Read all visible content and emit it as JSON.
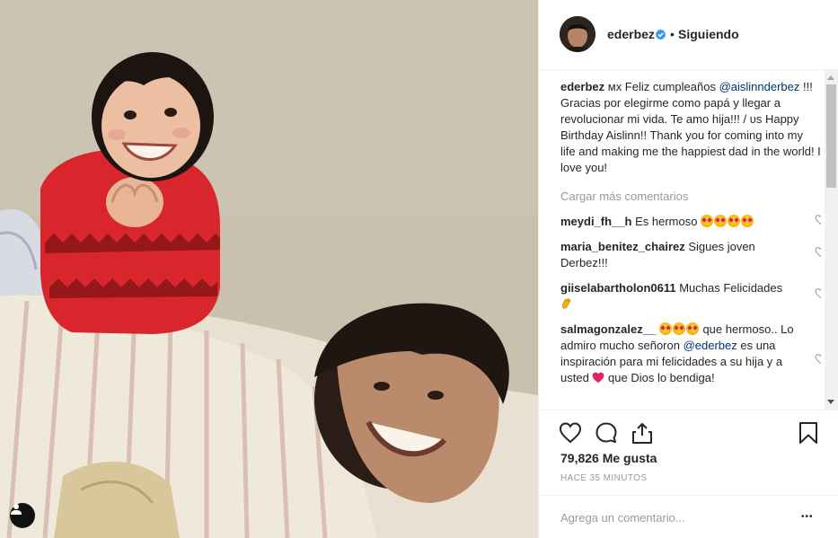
{
  "post": {
    "username": "ederbez",
    "follow_status": "Siguiendo",
    "header_separator": "•",
    "caption": {
      "username": "ederbez",
      "text_1": " ᴍx Feliz cumpleaños ",
      "mention": "@aislinnderbez",
      "text_2": " !!! Gracias por elegirme como papá y llegar a revolucionar mi vida. Te amo hija!!! / ᴜs Happy Birthday Aislinn!! Thank you for coming into my life and making me the happiest dad in the world! I love you!"
    },
    "load_more_label": "Cargar más comentarios",
    "comments": [
      {
        "username": "meydi_fh__h",
        "text": " Es hermoso"
      },
      {
        "username": "maria_benitez_chairez",
        "text": " Sigues joven Derbez!!!"
      },
      {
        "username": "giiselabartholon0611",
        "text": " Muchas Felicidades "
      },
      {
        "username": "salmagonzalez__",
        "text_1": " que hermoso.. Lo admiro mucho señoron ",
        "mention": "@ederbez",
        "text_2": " es una inspiración para mi felicidades a su hija y a usted ",
        "text_3": " que Dios lo bendiga!"
      }
    ],
    "likes": "79,826 Me gusta",
    "timestamp": "Hace 35 minutos",
    "comment_placeholder": "Agrega un comentario...",
    "more_options": "•••"
  },
  "icons": {
    "verified": "verified-badge-icon",
    "like": "heart-outline-icon",
    "comment": "comment-bubble-icon",
    "share": "share-upload-icon",
    "save": "bookmark-icon",
    "user_tag": "person-tag-icon",
    "comment_like": "small-heart-icon",
    "emoji": "heart-eyes-emoji"
  },
  "colors": {
    "text": "#262626",
    "muted": "#999999",
    "mention": "#003569",
    "verified": "#3897f0",
    "border": "#efefef"
  }
}
